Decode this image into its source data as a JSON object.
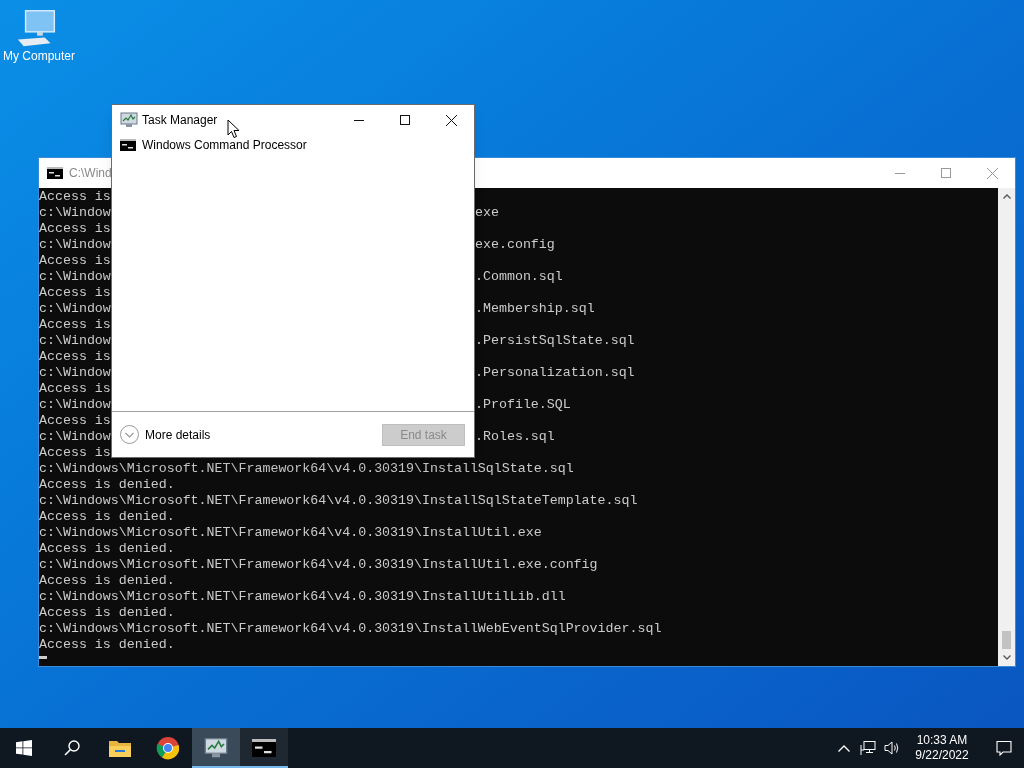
{
  "desktop": {
    "icons": [
      {
        "label": "My Computer"
      }
    ]
  },
  "console_window": {
    "title": "C:\\Wind",
    "lines": [
      {
        "left": "Access is"
      },
      {
        "left": "c:\\Window",
        "right": "exe"
      },
      {
        "left": "Access is"
      },
      {
        "left": "c:\\Window",
        "right": "exe.config"
      },
      {
        "left": "Access is"
      },
      {
        "left": "c:\\Window",
        "right": ".Common.sql"
      },
      {
        "left": "Access is"
      },
      {
        "left": "c:\\Window",
        "right": ".Membership.sql"
      },
      {
        "left": "Access is"
      },
      {
        "left": "c:\\Window",
        "right": ".PersistSqlState.sql"
      },
      {
        "left": "Access is"
      },
      {
        "left": "c:\\Window",
        "right": ".Personalization.sql"
      },
      {
        "left": "Access is"
      },
      {
        "left": "c:\\Window",
        "right": ".Profile.SQL"
      },
      {
        "left": "Access is"
      },
      {
        "left": "c:\\Window",
        "right": ".Roles.sql"
      },
      {
        "left": "Access is"
      },
      {
        "left": "c:\\Windows\\Microsoft.NET\\Framework64\\v4.0.30319\\InstallSqlState.sql"
      },
      {
        "left": "Access is denied."
      },
      {
        "left": "c:\\Windows\\Microsoft.NET\\Framework64\\v4.0.30319\\InstallSqlStateTemplate.sql"
      },
      {
        "left": "Access is denied."
      },
      {
        "left": "c:\\Windows\\Microsoft.NET\\Framework64\\v4.0.30319\\InstallUtil.exe"
      },
      {
        "left": "Access is denied."
      },
      {
        "left": "c:\\Windows\\Microsoft.NET\\Framework64\\v4.0.30319\\InstallUtil.exe.config"
      },
      {
        "left": "Access is denied."
      },
      {
        "left": "c:\\Windows\\Microsoft.NET\\Framework64\\v4.0.30319\\InstallUtilLib.dll"
      },
      {
        "left": "Access is denied."
      },
      {
        "left": "c:\\Windows\\Microsoft.NET\\Framework64\\v4.0.30319\\InstallWebEventSqlProvider.sql"
      },
      {
        "left": "Access is denied."
      }
    ]
  },
  "task_manager": {
    "title": "Task Manager",
    "apps": [
      {
        "name": "Windows Command Processor"
      }
    ],
    "more_details": "More details",
    "end_task": {
      "label": "End task",
      "disabled": true
    }
  },
  "taskbar": {
    "apps": [
      {
        "kind": "folder",
        "running": false,
        "selected": false
      },
      {
        "kind": "browser",
        "running": false,
        "selected": false
      },
      {
        "kind": "taskmgr",
        "running": true,
        "selected": true
      },
      {
        "kind": "console",
        "running": true,
        "selected": false
      }
    ],
    "time": "10:33 AM",
    "date": "9/22/2022"
  }
}
